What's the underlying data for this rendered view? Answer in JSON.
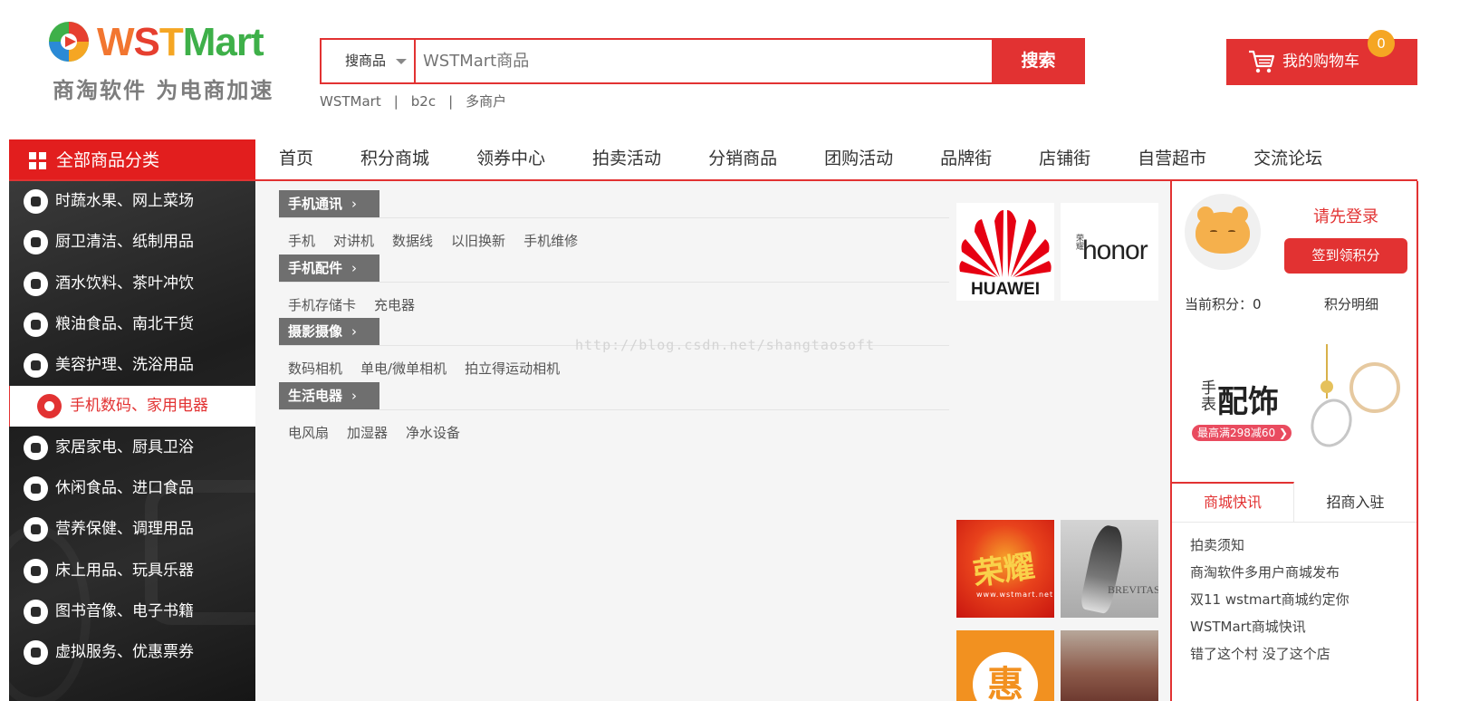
{
  "logo": {
    "brand": {
      "w": "W",
      "s": "S",
      "t": "T",
      "m": "Mart"
    },
    "slogan": "商淘软件 为电商加速"
  },
  "search": {
    "type_label": "搜商品",
    "placeholder": "WSTMart商品",
    "button_label": "搜索",
    "hotwords": [
      "WSTMart",
      "b2c",
      "多商户"
    ],
    "separator": "|"
  },
  "cart": {
    "label": "我的购物车",
    "count": "0"
  },
  "nav": {
    "all_categories": "全部商品分类",
    "links": [
      "首页",
      "积分商城",
      "领券中心",
      "拍卖活动",
      "分销商品",
      "团购活动",
      "品牌街",
      "店铺街",
      "自营超市",
      "交流论坛"
    ]
  },
  "categories": [
    "时蔬水果、网上菜场",
    "厨卫清洁、纸制用品",
    "酒水饮料、茶叶冲饮",
    "粮油食品、南北干货",
    "美容护理、洗浴用品",
    "手机数码、家用电器",
    "家居家电、厨具卫浴",
    "休闲食品、进口食品",
    "营养保健、调理用品",
    "床上用品、玩具乐器",
    "图书音像、电子书籍",
    "虚拟服务、优惠票券"
  ],
  "active_category_index": 5,
  "subcategories": [
    {
      "title": "手机通讯",
      "arrow": "›",
      "items": [
        "手机",
        "对讲机",
        "数据线",
        "以旧换新",
        "手机维修"
      ]
    },
    {
      "title": "手机配件",
      "arrow": "›",
      "items": [
        "手机存储卡",
        "充电器"
      ]
    },
    {
      "title": "摄影摄像",
      "arrow": "›",
      "items": [
        "数码相机",
        "单电/微单相机",
        "拍立得运动相机"
      ]
    },
    {
      "title": "生活电器",
      "arrow": "›",
      "items": [
        "电风扇",
        "加湿器",
        "净水设备"
      ]
    }
  ],
  "watermark": "http://blog.csdn.net/shangtaosoft",
  "brands": {
    "huawei": "HUAWEI",
    "honor": "honor",
    "honor_small": "荣耀"
  },
  "promos": {
    "promo1_text": "荣耀",
    "promo1_sub": "www.wstmart.net",
    "promo2_text": "BREVITAS",
    "promo3_text": "惠"
  },
  "user": {
    "login_tip": "请先登录",
    "sign_button": "签到领积分",
    "points_label": "当前积分：0",
    "points_detail": "积分明细"
  },
  "ad": {
    "small": "手表",
    "big": "配饰",
    "tag": "最高满298减60 ❯"
  },
  "news": {
    "tabs": [
      "商城快讯",
      "招商入驻"
    ],
    "items": [
      "拍卖须知",
      "商淘软件多用户商城发布",
      "双11 wstmart商城约定你",
      "WSTMart商城快讯",
      "错了这个村 没了这个店"
    ]
  },
  "colors": {
    "accent": "#e23232",
    "dark_menu": "#222222",
    "badge": "#f5a623"
  }
}
